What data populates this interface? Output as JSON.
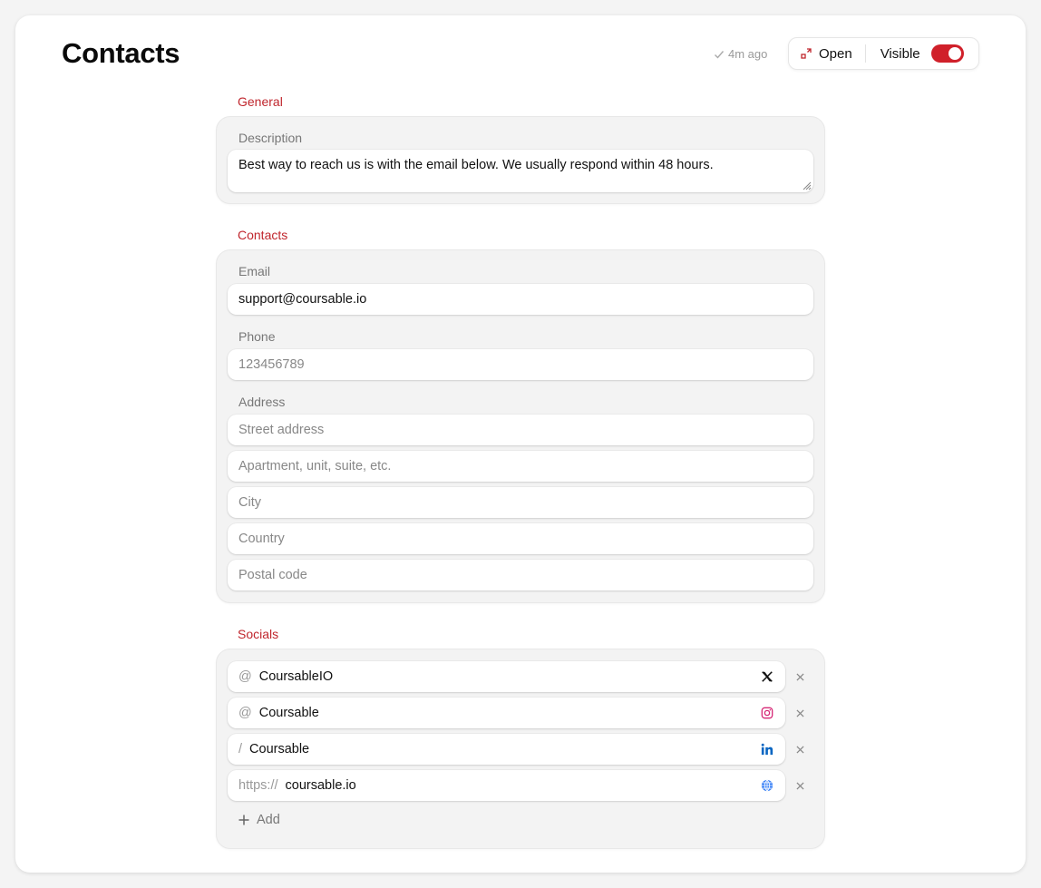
{
  "header": {
    "title": "Contacts",
    "saved_status": "4m ago",
    "open_label": "Open",
    "visible_label": "Visible",
    "visible_on": true
  },
  "colors": {
    "accent": "#c0262d",
    "toggle_on": "#d0202a"
  },
  "sections": {
    "general": {
      "label": "General",
      "description_label": "Description",
      "description_value": "Best way to reach us is with the email below. We usually respond within 48 hours."
    },
    "contacts": {
      "label": "Contacts",
      "email_label": "Email",
      "email_value": "support@coursable.io",
      "phone_label": "Phone",
      "phone_placeholder": "123456789",
      "address_label": "Address",
      "address_fields": [
        {
          "placeholder": "Street address"
        },
        {
          "placeholder": "Apartment, unit, suite, etc."
        },
        {
          "placeholder": "City"
        },
        {
          "placeholder": "Country"
        },
        {
          "placeholder": "Postal code"
        }
      ]
    },
    "socials": {
      "label": "Socials",
      "items": [
        {
          "prefix": "@",
          "value": "CoursableIO",
          "icon": "x-twitter-icon"
        },
        {
          "prefix": "@",
          "value": "Coursable",
          "icon": "instagram-icon"
        },
        {
          "prefix": "/",
          "value": "Coursable",
          "icon": "linkedin-icon"
        },
        {
          "prefix": "https://",
          "value": "coursable.io",
          "icon": "globe-icon"
        }
      ],
      "add_label": "Add"
    }
  }
}
